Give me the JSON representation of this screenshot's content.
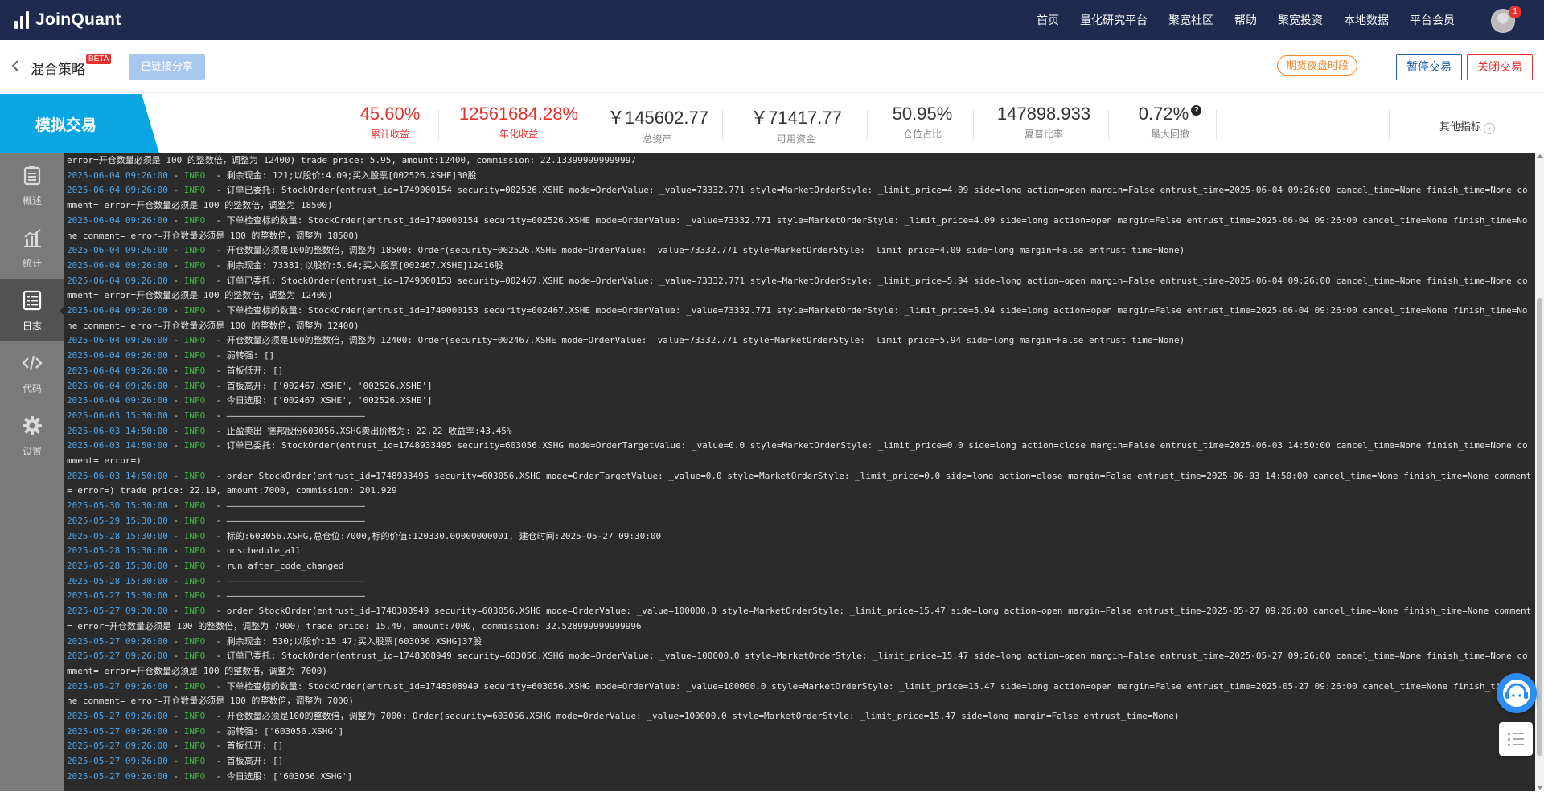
{
  "brand": {
    "name": "JoinQuant"
  },
  "nav": {
    "items": [
      "首页",
      "量化研究平台",
      "聚宽社区",
      "帮助",
      "聚宽投资",
      "本地数据",
      "平台会员"
    ],
    "avatar_badge": "1"
  },
  "strategy": {
    "title": "混合策略",
    "beta": "BETA",
    "share_label": "已链接分享",
    "night_badge": "期货夜盘时段",
    "pause_label": "暂停交易",
    "close_label": "关闭交易"
  },
  "sim_tab": "模拟交易",
  "metrics": [
    {
      "value": "45.60%",
      "label": "累计收益",
      "highlight": true
    },
    {
      "value": "12561684.28%",
      "label": "年化收益",
      "highlight": true
    },
    {
      "value": "￥145602.77",
      "label": "总资产",
      "highlight": false
    },
    {
      "value": "￥71417.77",
      "label": "可用资金",
      "highlight": false
    },
    {
      "value": "50.95%",
      "label": "仓位占比",
      "highlight": false
    },
    {
      "value": "147898.933",
      "label": "夏普比率",
      "highlight": false
    },
    {
      "value": "0.72%",
      "label": "最大回撤",
      "highlight": false
    }
  ],
  "other_metrics": "其他指标",
  "sidebar": [
    {
      "label": "概述",
      "icon": "clipboard-icon"
    },
    {
      "label": "统计",
      "icon": "bar-chart-icon"
    },
    {
      "label": "日志",
      "icon": "log-list-icon",
      "active": true
    },
    {
      "label": "代码",
      "icon": "code-icon"
    },
    {
      "label": "设置",
      "icon": "gear-icon"
    }
  ],
  "log_lines": [
    {
      "ts": "",
      "level": "",
      "msg": "error=开仓数量必须是 100 的整数倍，调整为 12400) trade price: 5.95, amount:12400, commission: 22.133999999999997"
    },
    {
      "ts": "2025-06-04 09:26:00",
      "level": "INFO",
      "msg": "剩余现金: 121;以股价:4.09;买入股票[002526.XSHE]30股"
    },
    {
      "ts": "2025-06-04 09:26:00",
      "level": "INFO",
      "msg": "订单已委托: StockOrder(entrust_id=1749000154 security=002526.XSHE mode=OrderValue: _value=73332.771 style=MarketOrderStyle: _limit_price=4.09 side=long action=open margin=False entrust_time=2025-06-04 09:26:00 cancel_time=None finish_time=None comment= error=开仓数量必须是 100 的整数倍，调整为 18500)"
    },
    {
      "ts": "2025-06-04 09:26:00",
      "level": "INFO",
      "msg": "下单检查标的数量: StockOrder(entrust_id=1749000154 security=002526.XSHE mode=OrderValue: _value=73332.771 style=MarketOrderStyle: _limit_price=4.09 side=long action=open margin=False entrust_time=2025-06-04 09:26:00 cancel_time=None finish_time=None comment= error=开仓数量必须是 100 的整数倍，调整为 18500)"
    },
    {
      "ts": "2025-06-04 09:26:00",
      "level": "INFO",
      "msg": "开仓数量必须是100的整数倍，调整为 18500: Order(security=002526.XSHE mode=OrderValue: _value=73332.771 style=MarketOrderStyle: _limit_price=4.09 side=long margin=False entrust_time=None)"
    },
    {
      "ts": "2025-06-04 09:26:00",
      "level": "INFO",
      "msg": "剩余现金: 73381;以股价:5.94;买入股票[002467.XSHE]12416股"
    },
    {
      "ts": "2025-06-04 09:26:00",
      "level": "INFO",
      "msg": "订单已委托: StockOrder(entrust_id=1749000153 security=002467.XSHE mode=OrderValue: _value=73332.771 style=MarketOrderStyle: _limit_price=5.94 side=long action=open margin=False entrust_time=2025-06-04 09:26:00 cancel_time=None finish_time=None comment= error=开仓数量必须是 100 的整数倍，调整为 12400)"
    },
    {
      "ts": "2025-06-04 09:26:00",
      "level": "INFO",
      "msg": "下单检查标的数量: StockOrder(entrust_id=1749000153 security=002467.XSHE mode=OrderValue: _value=73332.771 style=MarketOrderStyle: _limit_price=5.94 side=long action=open margin=False entrust_time=2025-06-04 09:26:00 cancel_time=None finish_time=None comment= error=开仓数量必须是 100 的整数倍，调整为 12400)"
    },
    {
      "ts": "2025-06-04 09:26:00",
      "level": "INFO",
      "msg": "开仓数量必须是100的整数倍，调整为 12400: Order(security=002467.XSHE mode=OrderValue: _value=73332.771 style=MarketOrderStyle: _limit_price=5.94 side=long margin=False entrust_time=None)"
    },
    {
      "ts": "2025-06-04 09:26:00",
      "level": "INFO",
      "msg": "弱转强: []"
    },
    {
      "ts": "2025-06-04 09:26:00",
      "level": "INFO",
      "msg": "首板低开: []"
    },
    {
      "ts": "2025-06-04 09:26:00",
      "level": "INFO",
      "msg": "首板高开: ['002467.XSHE', '002526.XSHE']"
    },
    {
      "ts": "2025-06-04 09:26:00",
      "level": "INFO",
      "msg": "今日选股: ['002467.XSHE', '002526.XSHE']"
    },
    {
      "ts": "2025-06-03 15:30:00",
      "level": "INFO",
      "msg": "——————————————————————————"
    },
    {
      "ts": "2025-06-03 14:50:00",
      "level": "INFO",
      "msg": "止盈卖出 德邦股份603056.XSHG卖出价格为: 22.22 收益率:43.45%"
    },
    {
      "ts": "2025-06-03 14:50:00",
      "level": "INFO",
      "msg": "订单已委托: StockOrder(entrust_id=1748933495 security=603056.XSHG mode=OrderTargetValue: _value=0.0 style=MarketOrderStyle: _limit_price=0.0 side=long action=close margin=False entrust_time=2025-06-03 14:50:00 cancel_time=None finish_time=None comment= error=)"
    },
    {
      "ts": "2025-06-03 14:50:00",
      "level": "INFO",
      "msg": "order StockOrder(entrust_id=1748933495 security=603056.XSHG mode=OrderTargetValue: _value=0.0 style=MarketOrderStyle: _limit_price=0.0 side=long action=close margin=False entrust_time=2025-06-03 14:50:00 cancel_time=None finish_time=None comment= error=) trade price: 22.19, amount:7000, commission: 201.929"
    },
    {
      "ts": "2025-05-30 15:30:00",
      "level": "INFO",
      "msg": "——————————————————————————"
    },
    {
      "ts": "2025-05-29 15:30:00",
      "level": "INFO",
      "msg": "——————————————————————————"
    },
    {
      "ts": "2025-05-28 15:30:00",
      "level": "INFO",
      "msg": "标的:603056.XSHG,总仓位:7000,标的价值:120330.00000000001, 建仓时间:2025-05-27 09:30:00"
    },
    {
      "ts": "2025-05-28 15:30:00",
      "level": "INFO",
      "msg": "unschedule_all"
    },
    {
      "ts": "2025-05-28 15:30:00",
      "level": "INFO",
      "msg": "run after_code_changed"
    },
    {
      "ts": "2025-05-28 15:30:00",
      "level": "INFO",
      "msg": "——————————————————————————"
    },
    {
      "ts": "2025-05-27 15:30:00",
      "level": "INFO",
      "msg": "——————————————————————————"
    },
    {
      "ts": "2025-05-27 09:30:00",
      "level": "INFO",
      "msg": "order StockOrder(entrust_id=1748308949 security=603056.XSHG mode=OrderValue: _value=100000.0 style=MarketOrderStyle: _limit_price=15.47 side=long action=open margin=False entrust_time=2025-05-27 09:26:00 cancel_time=None finish_time=None comment= error=开仓数量必须是 100 的整数倍，调整为 7000) trade price: 15.49, amount:7000, commission: 32.528999999999996"
    },
    {
      "ts": "2025-05-27 09:26:00",
      "level": "INFO",
      "msg": "剩余现金: 530;以股价:15.47;买入股票[603056.XSHG]37股"
    },
    {
      "ts": "2025-05-27 09:26:00",
      "level": "INFO",
      "msg": "订单已委托: StockOrder(entrust_id=1748308949 security=603056.XSHG mode=OrderValue: _value=100000.0 style=MarketOrderStyle: _limit_price=15.47 side=long action=open margin=False entrust_time=2025-05-27 09:26:00 cancel_time=None finish_time=None comment= error=开仓数量必须是 100 的整数倍，调整为 7000)"
    },
    {
      "ts": "2025-05-27 09:26:00",
      "level": "INFO",
      "msg": "下单检查标的数量: StockOrder(entrust_id=1748308949 security=603056.XSHG mode=OrderValue: _value=100000.0 style=MarketOrderStyle: _limit_price=15.47 side=long action=open margin=False entrust_time=2025-05-27 09:26:00 cancel_time=None finish_time=None comment= error=开仓数量必须是 100 的整数倍，调整为 7000)"
    },
    {
      "ts": "2025-05-27 09:26:00",
      "level": "INFO",
      "msg": "开仓数量必须是100的整数倍，调整为 7000: Order(security=603056.XSHG mode=OrderValue: _value=100000.0 style=MarketOrderStyle: _limit_price=15.47 side=long margin=False entrust_time=None)"
    },
    {
      "ts": "2025-05-27 09:26:00",
      "level": "INFO",
      "msg": "弱转强: ['603056.XSHG']"
    },
    {
      "ts": "2025-05-27 09:26:00",
      "level": "INFO",
      "msg": "首板低开: []"
    },
    {
      "ts": "2025-05-27 09:26:00",
      "level": "INFO",
      "msg": "首板高开: []"
    },
    {
      "ts": "2025-05-27 09:26:00",
      "level": "INFO",
      "msg": "今日选股: ['603056.XSHG']"
    }
  ],
  "colors": {
    "nav_bg": "#1e2b4f",
    "sim_tab_bg": "#0aa5e3",
    "accent_red": "#e8312f",
    "log_bg": "#2b2b2b",
    "log_ts": "#4fa3e6",
    "log_level": "#41b547"
  }
}
